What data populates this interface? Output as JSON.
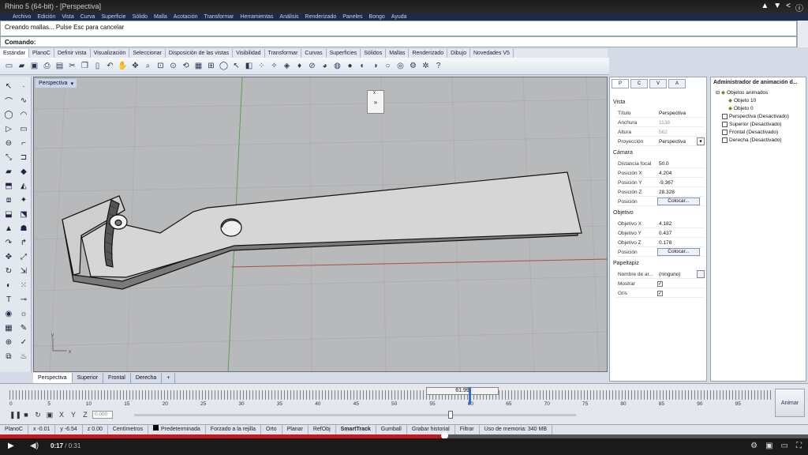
{
  "video": {
    "title": "Rhino 5 (64-bit) - [Perspectiva]",
    "current_time": "0:17",
    "duration": "/ 0:31",
    "progress": 0.55
  },
  "menu": [
    "Archivo",
    "Edición",
    "Vista",
    "Curva",
    "Superficie",
    "Sólido",
    "Malla",
    "Acotación",
    "Transformar",
    "Herramientas",
    "Análisis",
    "Renderizado",
    "Paneles",
    "Bongo",
    "Ayuda"
  ],
  "command": {
    "history": "Creando mallas... Pulse Esc para cancelar",
    "prompt": "Comando:"
  },
  "toolbar_tabs": [
    "Estándar",
    "PlanoC",
    "Definir vista",
    "Visualización",
    "Seleccionar",
    "Disposición de las vistas",
    "Visibilidad",
    "Transformar",
    "Curvas",
    "Superficies",
    "Sólidos",
    "Mallas",
    "Renderizado",
    "Dibujo",
    "Novedades V5"
  ],
  "viewport": {
    "title": "Perspectiva",
    "axis_y": "y",
    "axis_x": "x",
    "widget_close": "x",
    "widget_button": "»"
  },
  "viewport_tabs": [
    "Perspectiva",
    "Superior",
    "Frontal",
    "Derecha",
    "+"
  ],
  "properties": {
    "tabs": [
      "P",
      "C",
      "V",
      "A"
    ],
    "vista_header": "Vista",
    "titulo_label": "Título",
    "titulo_value": "Perspectiva",
    "anchura_label": "Anchura",
    "anchura_value": "1138",
    "altura_label": "Altura",
    "altura_value": "562",
    "proyeccion_label": "Proyección",
    "proyeccion_value": "Perspectiva",
    "camara_header": "Cámara",
    "distancia_label": "Distancia focal",
    "distancia_value": "50.0",
    "posx_label": "Posición X",
    "posx_value": "4.204",
    "posy_label": "Posición Y",
    "posy_value": "-9.367",
    "posz_label": "Posición Z",
    "posz_value": "28.328",
    "posicion_label": "Posición",
    "colocar": "Colocar...",
    "objetivo_header": "Objetivo",
    "objx_label": "Objetivo X",
    "objx_value": "4.182",
    "objy_label": "Objetivo Y",
    "objy_value": "0.437",
    "objz_label": "Objetivo Z",
    "objz_value": "0.178",
    "objpos_label": "Posición",
    "papeltapiz_header": "Papeltapiz",
    "nombre_label": "Nombre de ar...",
    "nombre_value": "(ninguno)",
    "mostrar_label": "Mostrar",
    "gris_label": "Gris",
    "check": "✓"
  },
  "animation": {
    "title": "Administrador de animación d...",
    "items": [
      "Objetos animados",
      "Objeto 10",
      "Objeto 0",
      "Perspectiva (Desactivado)",
      "Superior (Desactivado)",
      "Frontal (Desactivado)",
      "Derecha (Desactivado)"
    ]
  },
  "timeline": {
    "frame_display": "61.99",
    "ticks": [
      "0",
      "5",
      "10",
      "15",
      "20",
      "25",
      "30",
      "35",
      "40",
      "45",
      "50",
      "55",
      "60",
      "65",
      "70",
      "75",
      "80",
      "85",
      "90",
      "95"
    ],
    "frame_value": "0.000",
    "animar": "Animar",
    "axis_labels": [
      "X",
      "Y",
      "Z"
    ]
  },
  "statusbar": [
    "PlanoC",
    "x -0.01",
    "y -6.54",
    "z 0.00",
    "Centímetros",
    "Predeterminada",
    "Forzado a la rejilla",
    "Orto",
    "Planar",
    "RefObj",
    "SmartTrack",
    "Gumball",
    "Grabar historial",
    "Filtrar",
    "Uso de memoria: 340 MB"
  ],
  "colors": {
    "viewport_bg": "#b8b9bb",
    "progress_red": "#c4181f",
    "menubar": "#1e2a4a"
  }
}
